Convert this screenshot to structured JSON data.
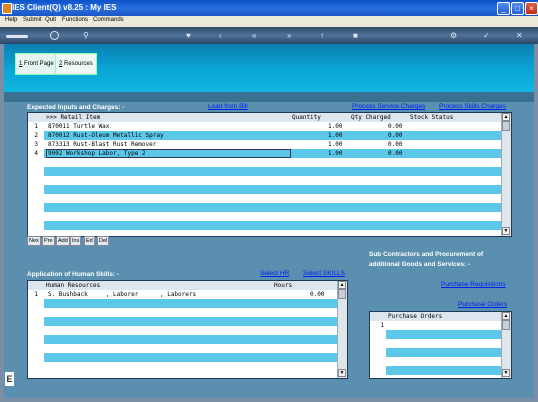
{
  "window": {
    "title": "IES Client(Q) v8.25 : My IES",
    "controls": [
      "minimize",
      "maximize",
      "close"
    ]
  },
  "menu": [
    "Help",
    "Submit",
    "Quit",
    "Functions",
    "Commands"
  ],
  "tabs": [
    {
      "key": "1",
      "label": "Front Page"
    },
    {
      "key": "2",
      "label": "Resources"
    }
  ],
  "inputs_section": {
    "title": "Expected Inputs and Charges: -",
    "links": {
      "load_from_bill": "Load from Bill",
      "process_service": "Process Service Charges",
      "process_skills": "Process Skills Charges"
    },
    "columns": [
      ">>> Retail Item",
      "Quantity",
      "Qty Charged",
      "Stock Status"
    ],
    "rows": [
      {
        "n": "1",
        "item": "870011 Turtle Wax",
        "qty": "1.00",
        "charged": "0.00",
        "status": ""
      },
      {
        "n": "2",
        "item": "870012 Rust-Oleum Metallic Spray",
        "qty": "1.00",
        "charged": "0.00",
        "status": ""
      },
      {
        "n": "3",
        "item": "873313 Rust-Blast Rust Remover",
        "qty": "1.00",
        "charged": "0.00",
        "status": ""
      },
      {
        "n": "4",
        "item": "9002 Workshop Labor, Type 2",
        "qty": "1.00",
        "charged": "0.00",
        "status": ""
      }
    ],
    "nav_buttons": [
      "Nex",
      "Pre",
      "Add",
      "Ins",
      "Ed",
      "Del"
    ]
  },
  "skills_section": {
    "title": "Application of Human Skills: -",
    "links": {
      "select_hr": "Select HR",
      "select_skills": "Select SKILLS"
    },
    "columns": [
      "Human Resources",
      "Hours"
    ],
    "rows": [
      {
        "n": "1",
        "resource": "S. Bushback     , Laborer      , Laborers",
        "hours": "0.00"
      }
    ]
  },
  "subcontract_section": {
    "title_line1": "Sub Contractors and Procurement of",
    "title_line2": "additional Goods and Services: -",
    "links": {
      "purchase_requisitions": "Purchase Requisitions",
      "purchase_orders": "Purchase Orders"
    },
    "columns": [
      "Purchase Orders"
    ],
    "rows": [
      {
        "n": "1",
        "value": ""
      }
    ]
  },
  "bottom_tag": "E",
  "colors": {
    "title_blue": "#0a52c8",
    "banner": "#0aa6d6",
    "panel": "#5a8fb0",
    "row_highlight": "#5bc8ea",
    "link": "#0022ee"
  }
}
